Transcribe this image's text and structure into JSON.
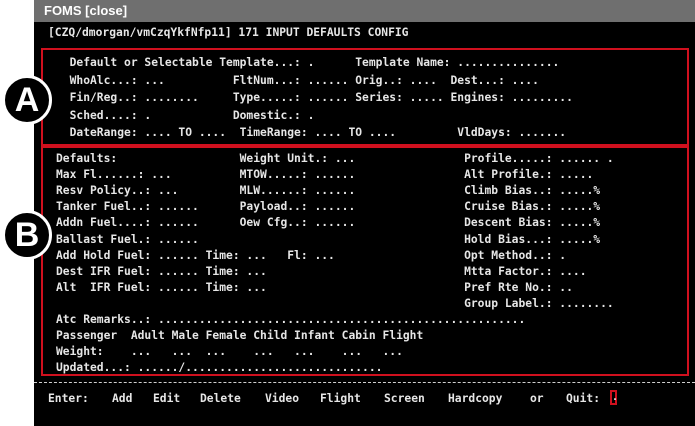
{
  "window": {
    "title": "FOMS [close]"
  },
  "header": {
    "line": "[CZQ/dmorgan/vmCzqYkfNfp11] 171 INPUT DEFAULTS CONFIG"
  },
  "section_a": {
    "marker": "A",
    "lines": [
      "  Default or Selectable Template...: .      Template Name: ...............",
      "  WhoAlc...: ...          FltNum...: ...... Orig..: ....  Dest...: ....",
      "  Fin/Reg..: ........     Type.....: ...... Series: ..... Engines: .........",
      "  Sched....: .            Domestic.: .",
      "  DateRange: .... TO ....  TimeRange: .... TO ....         VldDays: ......."
    ]
  },
  "section_b": {
    "marker": "B",
    "lines": [
      "Defaults:                  Weight Unit.: ...                Profile.....: ...... .",
      "Max Fl......: ...          MTOW.....: ......                Alt Profile.: .....",
      "Resv Policy..: ...         MLW......: ......                Climb Bias..: .....%",
      "Tanker Fuel..: ......      Payload..: ......                Cruise Bias.: .....%",
      "Addn Fuel....: ......      Oew Cfg..: ......                Descent Bias: .....%",
      "Ballast Fuel.: ......                                       Hold Bias...: .....%",
      "Add Hold Fuel: ...... Time: ...   Fl: ...                   Opt Method..: .",
      "Dest IFR Fuel: ...... Time: ...                             Mtta Factor.: ....",
      "Alt  IFR Fuel: ...... Time: ...                             Pref Rte No.: ..",
      "                                                            Group Label.: ........",
      "Atc Remarks..: ......................................................",
      "Passenger  Adult Male Female Child Infant Cabin Flight",
      "Weight:    ...   ...  ...    ...   ...    ...   ...",
      "Updated...: ....../............................."
    ]
  },
  "footer": {
    "prompt": "Enter:",
    "commands": [
      "Add",
      "Edit",
      "Delete",
      "Video",
      "Flight",
      "Screen",
      "Hardcopy"
    ],
    "or_label": "or",
    "quit": "Quit:",
    "cursor": "."
  },
  "colors": {
    "background": "#000000",
    "text": "#e6e6e6",
    "titlebar": "#6f6f6f",
    "highlight_box": "#d0101e"
  }
}
